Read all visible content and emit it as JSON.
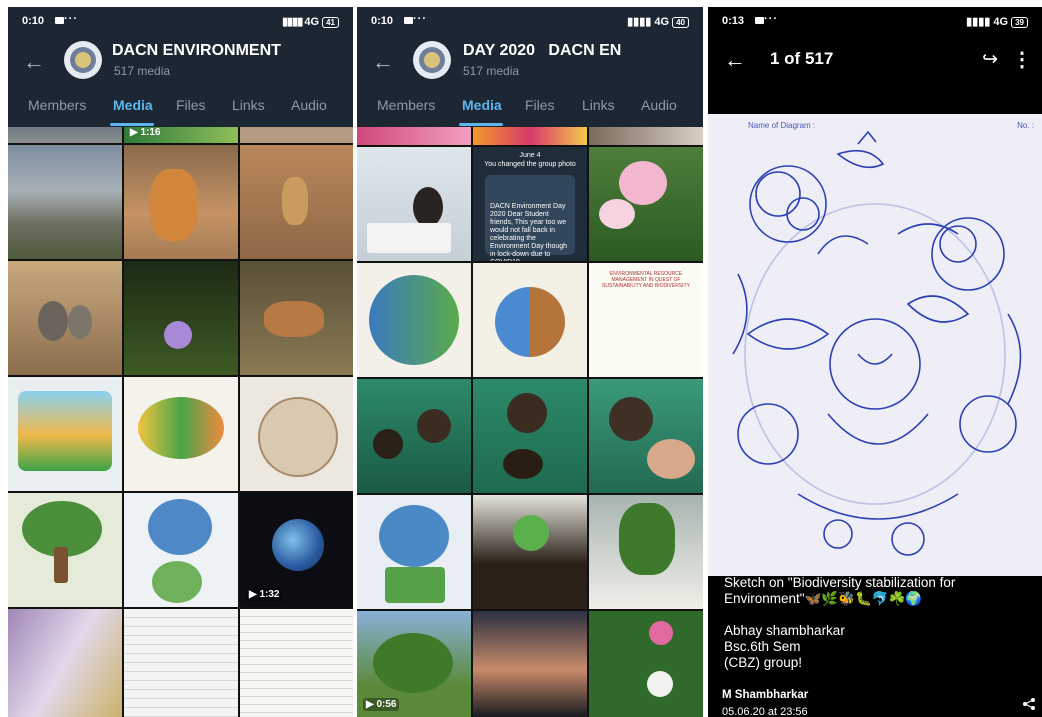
{
  "screens": [
    {
      "status": {
        "time": "0:10",
        "dots": "···",
        "network": "4G",
        "battery": "41"
      },
      "header": {
        "title": "DACN ENVIRONMENT",
        "subtitle": "517 media"
      },
      "tabs": [
        "Members",
        "Media",
        "Files",
        "Links",
        "Audio"
      ],
      "active_tab": "Media",
      "overlays": {
        "top_video": "▶ 1:16",
        "earth_video": "▶ 1:32"
      }
    },
    {
      "status": {
        "time": "0:10",
        "dots": "···",
        "network": "4G",
        "battery": "40"
      },
      "header": {
        "title": "DAY 2020   DACN EN",
        "subtitle": "517 media"
      },
      "tabs": [
        "Members",
        "Media",
        "Files",
        "Links",
        "Audio"
      ],
      "active_tab": "Media",
      "chat_thumb": {
        "date": "June 4",
        "notice": "You changed the group photo",
        "message": "DACN Environment Day 2020 Dear Student friends, This year too we would not fall back in celebrating the Environment Day though in lock-down due to COVID19"
      },
      "poster_thumb": {
        "title": "ENVIRONMENTAL RESOURCE MANAGEMENT IN QUEST OF SUSTAINABILITY AND BIODIVERSITY"
      },
      "overlays": {
        "bottom_video": "▶ 0:56"
      }
    },
    {
      "status": {
        "time": "0:13",
        "dots": "···",
        "network": "4G",
        "battery": "39"
      },
      "viewer": {
        "counter": "1 of 517"
      },
      "sketch": {
        "name_label": "Name of Diagram :",
        "no_label": "No. :"
      },
      "caption": {
        "line1": "Sketch on \"Biodiversity stabilization for Environment\"🦋🌿🐝🐛🐬☘️🌍",
        "line2": "Abhay shambharkar",
        "line3": "Bsc.6th Sem",
        "line4": "(CBZ) group!"
      },
      "author": "M Shambharkar",
      "date": "05.06.20 at 23:56"
    }
  ]
}
